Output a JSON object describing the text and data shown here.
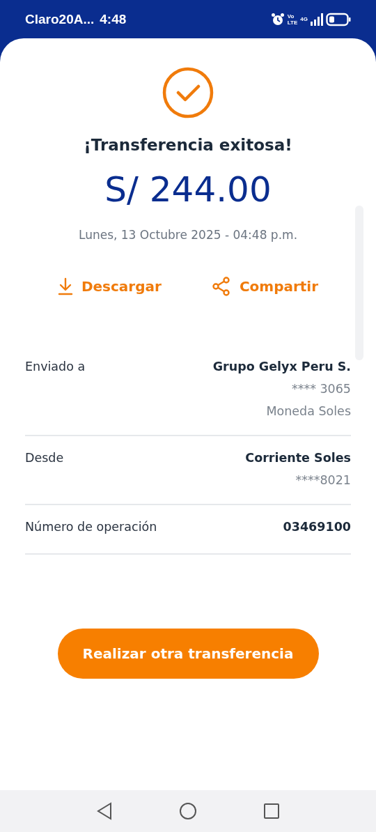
{
  "status_bar": {
    "carrier": "Claro20A...",
    "time": "4:48",
    "volte": [
      "Vo",
      "LTE"
    ],
    "network": "4G"
  },
  "result": {
    "title": "¡Transferencia exitosa!",
    "amount": "S/ 244.00",
    "datetime": "Lunes, 13 Octubre 2025 - 04:48 p.m."
  },
  "actions": [
    {
      "kind": "download",
      "label": "Descargar"
    },
    {
      "kind": "share",
      "label": "Compartir"
    }
  ],
  "details": [
    {
      "label": "Enviado a",
      "values": [
        {
          "text": "Grupo Gelyx Peru S.",
          "kind": "primary"
        },
        {
          "text": "**** 3065",
          "kind": "secondary"
        },
        {
          "text": "Moneda Soles",
          "kind": "secondary"
        }
      ]
    },
    {
      "label": "Desde",
      "values": [
        {
          "text": "Corriente Soles",
          "kind": "primary"
        },
        {
          "text": "****8021",
          "kind": "secondary"
        }
      ]
    },
    {
      "label": "Número de operación",
      "values": [
        {
          "text": "03469100",
          "kind": "primary"
        }
      ]
    }
  ],
  "primary_button": "Realizar otra transferencia"
}
